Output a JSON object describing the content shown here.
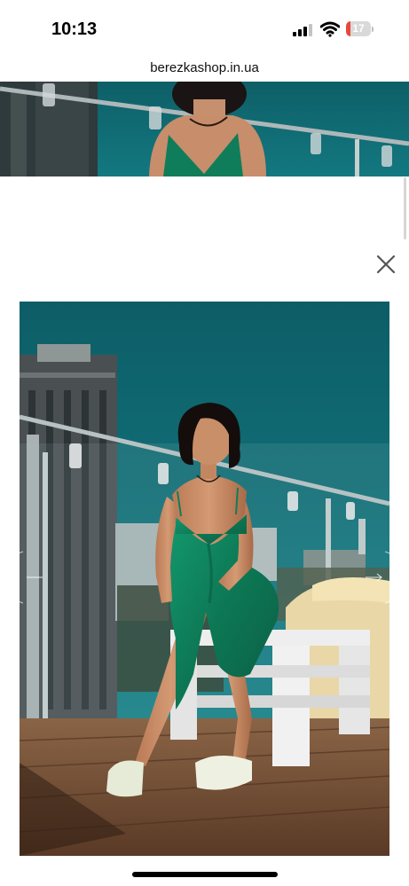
{
  "status_bar": {
    "time": "10:13",
    "battery_level": "17",
    "battery_fraction": 0.17,
    "battery_color": "#e9473b",
    "icons": [
      "signal-icon",
      "wifi-icon",
      "battery-icon"
    ]
  },
  "browser": {
    "url": "berezkashop.in.ua"
  },
  "gallery": {
    "close_icon": "close-icon",
    "prev_icon": "chevron-left-icon",
    "next_icon": "chevron-right-icon",
    "photo_subject": "model-in-green-satin-dress",
    "accent_colors": {
      "sky": "#116b72",
      "dress": "#0f7d5a",
      "deck": "#6e4a32"
    }
  }
}
